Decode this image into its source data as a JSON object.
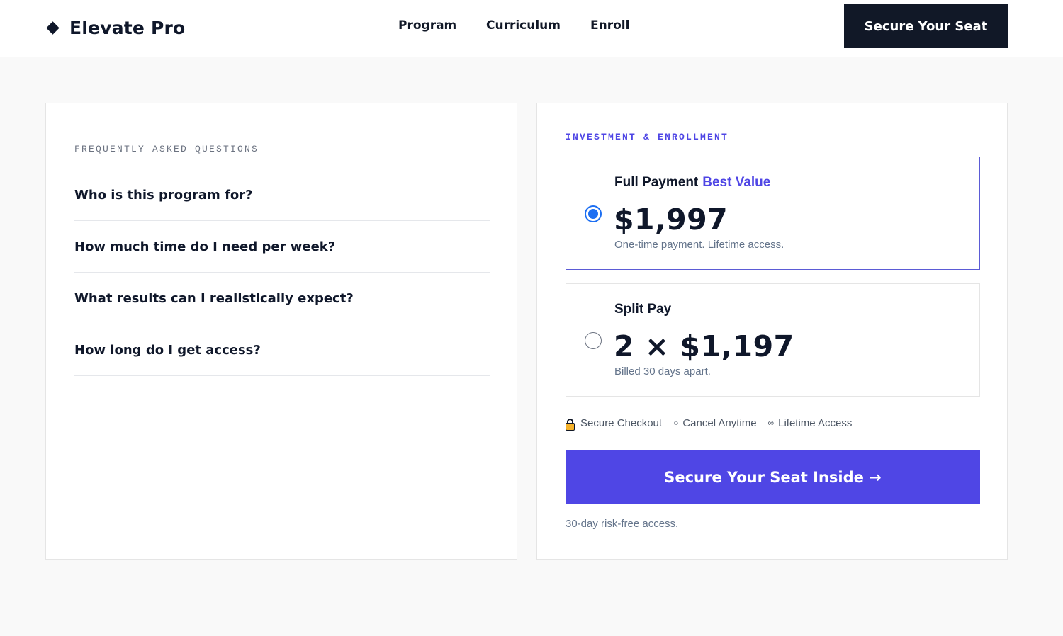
{
  "header": {
    "brand": "Elevate Pro",
    "brand_icon": "diamond-icon",
    "nav": [
      "Program",
      "Curriculum",
      "Enroll"
    ],
    "cta": "Secure Your Seat"
  },
  "faq": {
    "eyebrow": "FREQUENTLY ASKED QUESTIONS",
    "questions": [
      "Who is this program for?",
      "How much time do I need per week?",
      "What results can I realistically expect?",
      "How long do I get access?"
    ]
  },
  "enrollment": {
    "eyebrow": "INVESTMENT & ENROLLMENT",
    "plans": [
      {
        "title": "Full Payment",
        "badge": "Best Value",
        "price": "$1,997",
        "note": "One-time payment. Lifetime access.",
        "selected": true
      },
      {
        "title": "Split Pay",
        "badge": "",
        "price": "2 × $1,197",
        "note": "Billed 30 days apart.",
        "selected": false
      }
    ],
    "trust": [
      {
        "icon": "lock-icon",
        "label": "Secure Checkout"
      },
      {
        "icon": "circle-icon",
        "glyph": "○",
        "label": "Cancel Anytime"
      },
      {
        "icon": "infinity-icon",
        "glyph": "∞",
        "label": "Lifetime Access"
      }
    ],
    "cta": "Secure Your Seat Inside →",
    "footnote": "30-day risk-free access."
  },
  "colors": {
    "accent": "#4f46e5",
    "dark": "#111827",
    "radio_selected": "#1d6ff2",
    "page_bg": "#f9f9f9"
  }
}
